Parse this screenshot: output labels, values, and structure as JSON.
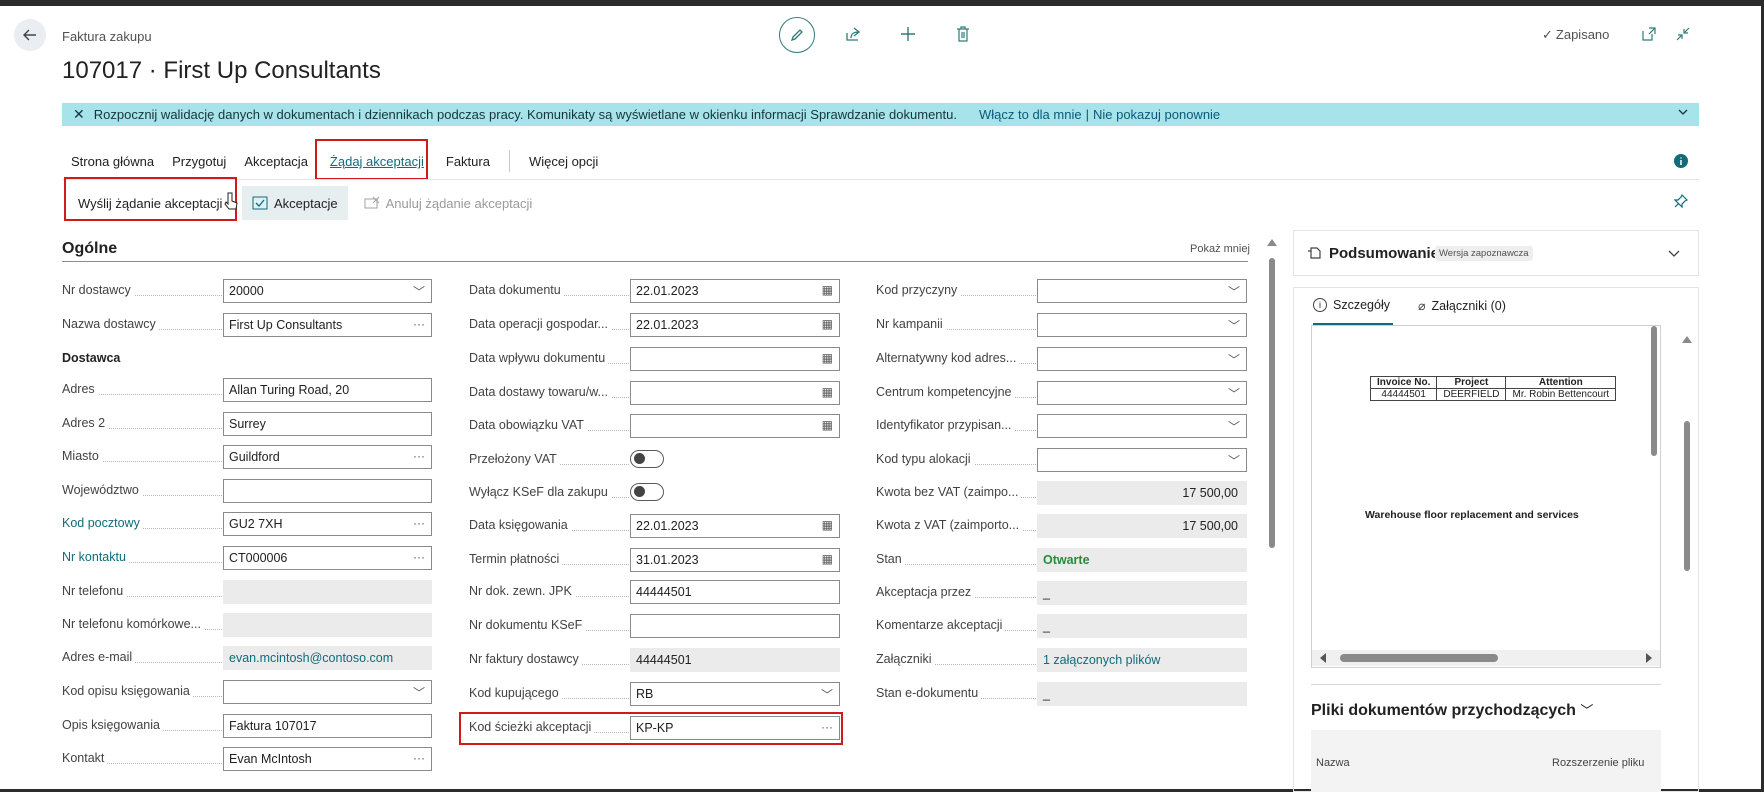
{
  "header": {
    "breadcrumb": "Faktura zakupu",
    "title": "107017 · First Up Consultants",
    "saved_status": "Zapisano"
  },
  "banner": {
    "message": "Rozpocznij walidację danych w dokumentach i dziennikach podczas pracy. Komunikaty są wyświetlane w okienku informacji Sprawdzanie dokumentu.",
    "enable_link": "Włącz to dla mnie",
    "separator": "|",
    "dismiss_link": "Nie pokazuj ponownie"
  },
  "tabs": {
    "home": "Strona główna",
    "prepare": "Przygotuj",
    "approval": "Akceptacja",
    "request_approval": "Żądaj akceptacji",
    "invoice": "Faktura",
    "more": "Więcej opcji"
  },
  "actions": {
    "send_request": "Wyślij żądanie akceptacji",
    "approvals": "Akceptacje",
    "cancel_request": "Anuluj żądanie akceptacji"
  },
  "general": {
    "title": "Ogólne",
    "show_less": "Pokaż mniej",
    "col1": {
      "vendor_no_label": "Nr dostawcy",
      "vendor_no": "20000",
      "vendor_name_label": "Nazwa dostawcy",
      "vendor_name": "First Up Consultants",
      "section_vendor": "Dostawca",
      "address_label": "Adres",
      "address": "Allan Turing Road, 20",
      "address2_label": "Adres 2",
      "address2": "Surrey",
      "city_label": "Miasto",
      "city": "Guildford",
      "county_label": "Województwo",
      "county": "",
      "post_code_label": "Kod pocztowy",
      "post_code": "GU2 7XH",
      "contact_no_label": "Nr kontaktu",
      "contact_no": "CT000006",
      "phone_label": "Nr telefonu",
      "phone": "",
      "mobile_label": "Nr telefonu komórkowe...",
      "mobile": "",
      "email_label": "Adres e-mail",
      "email": "evan.mcintosh@contoso.com",
      "posting_desc_code_label": "Kod opisu księgowania",
      "posting_desc_code": "",
      "posting_desc_label": "Opis księgowania",
      "posting_desc": "Faktura 107017",
      "contact_label": "Kontakt",
      "contact": "Evan McIntosh"
    },
    "col2": {
      "doc_date_label": "Data dokumentu",
      "doc_date": "22.01.2023",
      "op_date_label": "Data operacji gospodar...",
      "op_date": "22.01.2023",
      "receipt_date_label": "Data wpływu dokumentu",
      "receipt_date": "",
      "delivery_date_label": "Data dostawy towaru/w...",
      "delivery_date": "",
      "vat_date_label": "Data obowiązku VAT",
      "vat_date": "",
      "vat_postponed_label": "Przełożony VAT",
      "ksef_exclude_label": "Wyłącz KSeF dla zakupu",
      "posting_date_label": "Data księgowania",
      "posting_date": "22.01.2023",
      "due_date_label": "Termin płatności",
      "due_date": "31.01.2023",
      "ext_doc_jpk_label": "Nr dok. zewn. JPK",
      "ext_doc_jpk": "44444501",
      "ksef_doc_label": "Nr dokumentu KSeF",
      "ksef_doc": "",
      "vendor_invoice_label": "Nr faktury dostawcy",
      "vendor_invoice": "44444501",
      "purchaser_label": "Kod kupującego",
      "purchaser": "RB",
      "approval_path_label": "Kod ścieżki akceptacji",
      "approval_path": "KP-KP"
    },
    "col3": {
      "reason_label": "Kod przyczyny",
      "campaign_label": "Nr kampanii",
      "alt_address_label": "Alternatywny kod adres...",
      "responsibility_label": "Centrum kompetencyjne",
      "assigned_id_label": "Identyfikator przypisan...",
      "alloc_type_label": "Kod typu alokacji",
      "amount_excl_label": "Kwota bez VAT (zaimpo...",
      "amount_excl": "17 500,00",
      "amount_incl_label": "Kwota z VAT (zaimporto...",
      "amount_incl": "17 500,00",
      "status_label": "Stan",
      "status": "Otwarte",
      "approved_by_label": "Akceptacja przez",
      "approved_by": "_",
      "approval_comments_label": "Komentarze akceptacji",
      "approval_comments": "_",
      "attachments_label": "Załączniki",
      "attachments": "1 załączonych plików",
      "edoc_status_label": "Stan e-dokumentu",
      "edoc_status": "_"
    }
  },
  "factbox": {
    "summary_title": "Podsumowanie",
    "preview_badge": "Wersja zapoznawcza",
    "tab_details": "Szczegóły",
    "tab_attachments": "Załączniki (0)",
    "preview_table": {
      "headers": [
        "Invoice No.",
        "Project",
        "Attention"
      ],
      "row": [
        "44444501",
        "DEERFIELD",
        "Mr. Robin Bettencourt"
      ]
    },
    "preview_text": "Warehouse floor replacement and services",
    "incoming_files_title": "Pliki dokumentów przychodzących",
    "col_name": "Nazwa",
    "col_ext": "Rozszerzenie pliku"
  },
  "colors": {
    "accent": "#0f6c7a",
    "banner_bg": "#a7e3ea",
    "highlight": "#d11a1a",
    "status_green": "#2b8a3e"
  }
}
